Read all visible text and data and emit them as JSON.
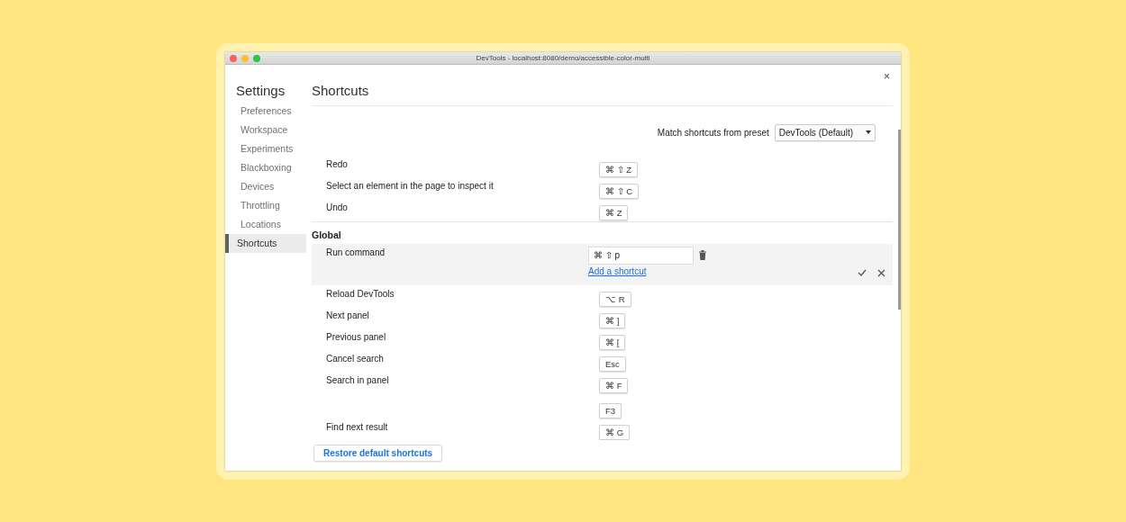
{
  "window": {
    "title": "DevTools - localhost:8080/demo/accessible-color-multi",
    "close": "×"
  },
  "sidebar": {
    "title": "Settings",
    "items": [
      {
        "label": "Preferences",
        "selected": false
      },
      {
        "label": "Workspace",
        "selected": false
      },
      {
        "label": "Experiments",
        "selected": false
      },
      {
        "label": "Blackboxing",
        "selected": false
      },
      {
        "label": "Devices",
        "selected": false
      },
      {
        "label": "Throttling",
        "selected": false
      },
      {
        "label": "Locations",
        "selected": false
      },
      {
        "label": "Shortcuts",
        "selected": true
      }
    ]
  },
  "panel": {
    "title": "Shortcuts",
    "preset": {
      "label": "Match shortcuts from preset",
      "value": "DevTools (Default)"
    },
    "groups": [
      {
        "rows": [
          {
            "name": "Redo",
            "editing": false,
            "keys": [
              "⌘ ⇧ Z"
            ]
          },
          {
            "name": "Select an element in the page to inspect it",
            "editing": false,
            "keys": [
              "⌘ ⇧ C"
            ]
          },
          {
            "name": "Undo",
            "editing": false,
            "keys": [
              "⌘ Z"
            ]
          }
        ]
      },
      {
        "title": "Global",
        "rows": [
          {
            "name": "Run command",
            "editing": true,
            "keys": [
              "⌘ ⇧ p"
            ],
            "add_link": "Add a shortcut"
          },
          {
            "name": "Reload DevTools",
            "editing": false,
            "keys": [
              "⌥ R"
            ]
          },
          {
            "name": "Next panel",
            "editing": false,
            "keys": [
              "⌘ ]"
            ]
          },
          {
            "name": "Previous panel",
            "editing": false,
            "keys": [
              "⌘ ["
            ]
          },
          {
            "name": "Cancel search",
            "editing": false,
            "keys": [
              "Esc"
            ]
          },
          {
            "name": "Search in panel",
            "editing": false,
            "keys": [
              "⌘ F",
              "F3"
            ]
          },
          {
            "name": "Find next result",
            "editing": false,
            "keys": [
              "⌘ G"
            ]
          }
        ]
      }
    ],
    "restore_button": "Restore default shortcuts"
  }
}
